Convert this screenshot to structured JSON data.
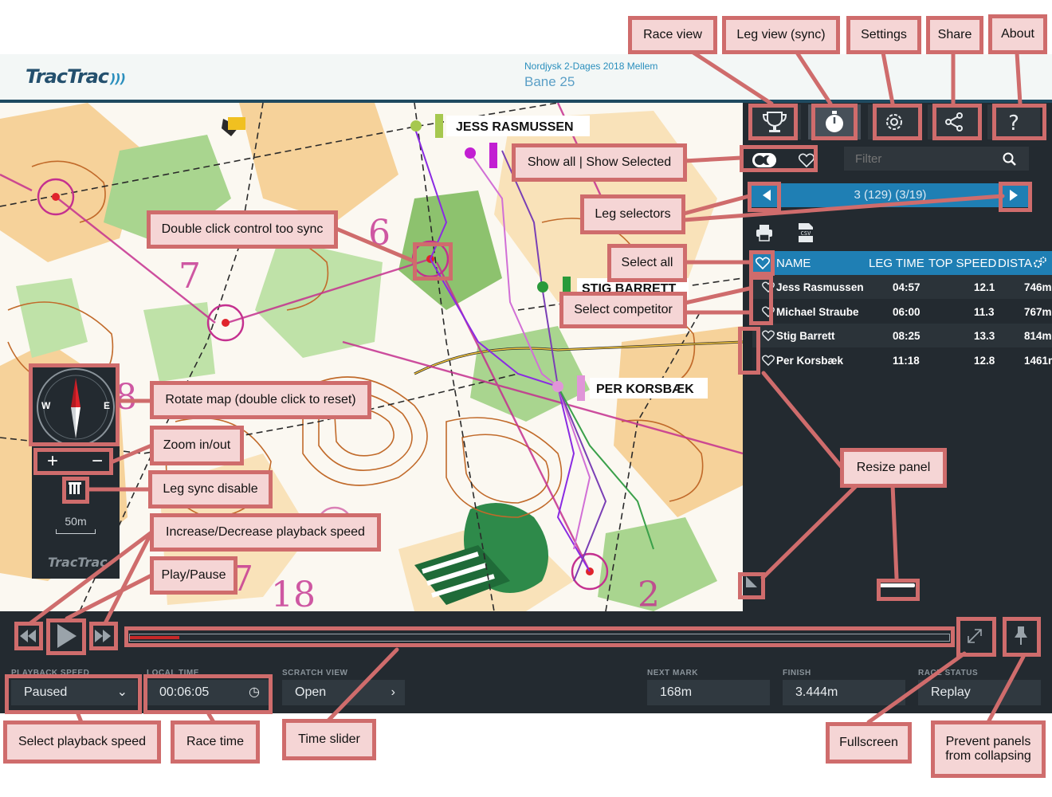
{
  "header": {
    "logo": "TracTrac",
    "event": "Nordjysk 2-Dages 2018 Mellem",
    "course": "Bane 25"
  },
  "map": {
    "competitor_labels": [
      "JESS RASMUSSEN",
      "STIG BARRETT",
      "PER KORSBÆK"
    ],
    "control_numbers": [
      "6",
      "7",
      "8",
      "17",
      "18",
      "2"
    ],
    "compass": {
      "west": "W",
      "east": "E"
    },
    "zoom_in": "+",
    "zoom_out": "−",
    "scale": "50m",
    "watermark": "TracTrac"
  },
  "panel": {
    "tabs": [
      {
        "name": "Race view",
        "icon": "trophy-icon"
      },
      {
        "name": "Leg view (sync)",
        "icon": "stopwatch-icon"
      },
      {
        "name": "Settings",
        "icon": "gear-icon"
      },
      {
        "name": "Share",
        "icon": "share-icon"
      },
      {
        "name": "About",
        "icon": "question-icon"
      }
    ],
    "filter_placeholder": "Filter",
    "leg_label": "3 (129) (3/19)",
    "table": {
      "headers": {
        "name": "NAME",
        "leg_time": "LEG TIME",
        "top_speed": "TOP SPEED",
        "distance": "DISTA"
      },
      "rows": [
        {
          "name": "Jess Rasmussen",
          "leg_time": "04:57",
          "top_speed": "12.1",
          "distance": "746m"
        },
        {
          "name": "Michael Straube",
          "leg_time": "06:00",
          "top_speed": "11.3",
          "distance": "767m"
        },
        {
          "name": "Stig Barrett",
          "leg_time": "08:25",
          "top_speed": "13.3",
          "distance": "814m"
        },
        {
          "name": "Per Korsbæk",
          "leg_time": "11:18",
          "top_speed": "12.8",
          "distance": "1461m"
        }
      ]
    }
  },
  "playback": {
    "progress": 0.06,
    "fields": {
      "playback_speed": {
        "label": "PLAYBACK SPEED",
        "value": "Paused"
      },
      "local_time": {
        "label": "LOCAL TIME",
        "value": "00:06:05"
      },
      "scratch_view": {
        "label": "SCRATCH VIEW",
        "value": "Open"
      },
      "next_mark": {
        "label": "NEXT MARK",
        "value": "168m"
      },
      "finish": {
        "label": "FINISH",
        "value": "3.444m"
      },
      "race_status": {
        "label": "RACE STATUS",
        "value": "Replay"
      }
    }
  },
  "callouts": {
    "race_view": "Race view",
    "leg_view": "Leg view (sync)",
    "settings": "Settings",
    "share": "Share",
    "about": "About",
    "show_all": "Show all | Show Selected",
    "leg_selectors": "Leg selectors",
    "double_click": "Double click control too sync",
    "select_all": "Select all",
    "select_competitor": "Select competitor",
    "rotate_map": "Rotate map (double click to reset)",
    "zoom": "Zoom in/out",
    "leg_sync": "Leg sync disable",
    "speed": "Increase/Decrease playback speed",
    "play_pause": "Play/Pause",
    "resize_panel": "Resize panel",
    "select_speed": "Select playback speed",
    "race_time": "Race time",
    "time_slider": "Time slider",
    "fullscreen": "Fullscreen",
    "prevent_panels": "Prevent panels from collapsing"
  },
  "colors": {
    "callout_border": "#cf6c6c",
    "callout_fill": "#f5d5d5",
    "panel_bg": "#232a30",
    "accent_blue": "#1f7fb4",
    "map_orange": "#f6d29a",
    "map_green": "#8dc26e",
    "contour_brown": "#c16a2a",
    "course_magenta": "#c4308f"
  }
}
